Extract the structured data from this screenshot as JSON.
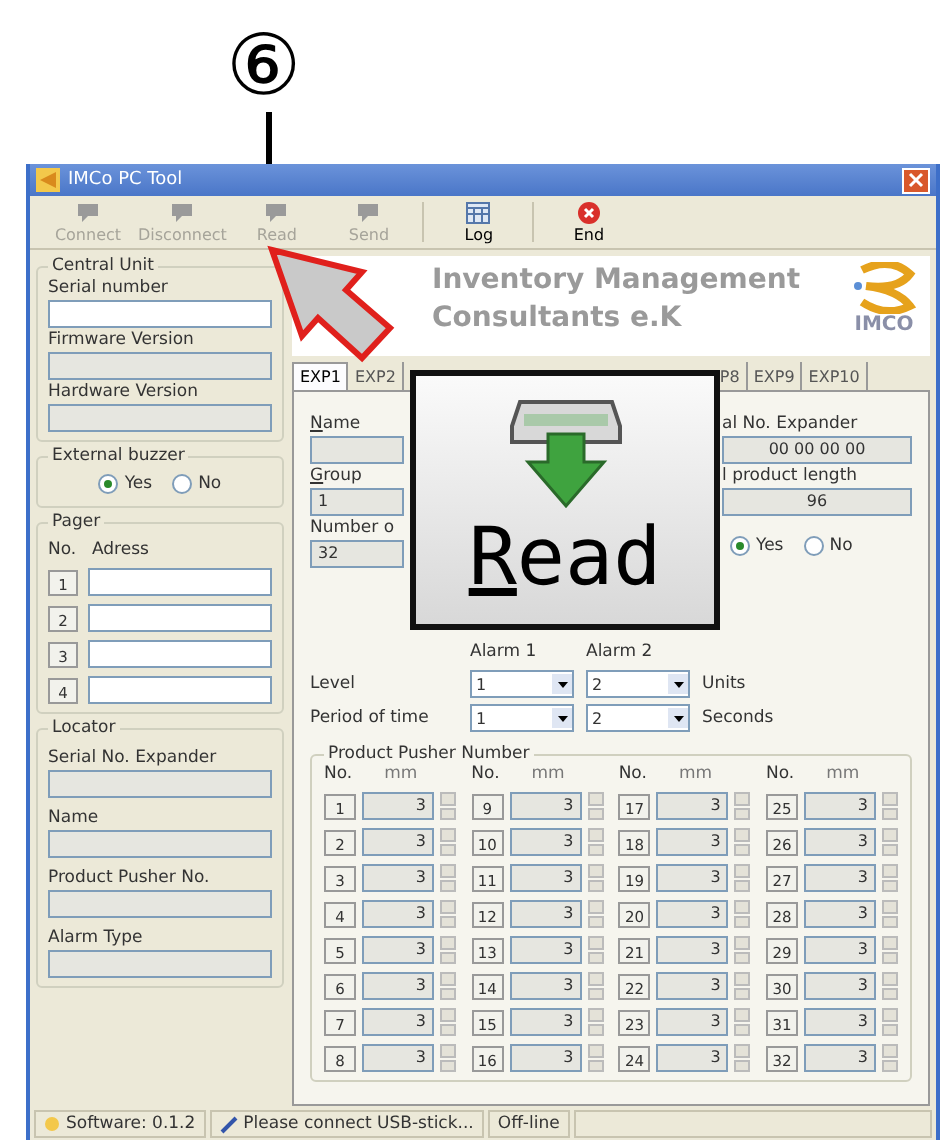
{
  "annotation": {
    "number": "⑥"
  },
  "callout": {
    "label": "Read"
  },
  "window": {
    "title": "IMCo PC Tool"
  },
  "toolbar": [
    {
      "label": "Connect",
      "kind": "bubble",
      "disabled": true
    },
    {
      "label": "Disconnect",
      "kind": "bubble",
      "disabled": true
    },
    {
      "label": "Read",
      "kind": "bubble",
      "disabled": true
    },
    {
      "label": "Send",
      "kind": "bubble",
      "disabled": true
    },
    {
      "label": "Log",
      "kind": "log",
      "disabled": false
    },
    {
      "label": "End",
      "kind": "end",
      "disabled": false
    }
  ],
  "central_unit": {
    "title": "Central Unit",
    "fields": [
      {
        "label": "Serial number",
        "editable": true
      },
      {
        "label": "Firmware Version",
        "editable": false
      },
      {
        "label": "Hardware Version",
        "editable": false
      }
    ]
  },
  "external_buzzer": {
    "title": "External buzzer",
    "options": [
      {
        "label": "Yes",
        "selected": true
      },
      {
        "label": "No",
        "selected": false
      }
    ]
  },
  "pager": {
    "title": "Pager",
    "col_no": "No.",
    "col_address": "Adress",
    "rows": [
      "1",
      "2",
      "3",
      "4"
    ]
  },
  "locator": {
    "title": "Locator",
    "fields": [
      "Serial No. Expander",
      "Name",
      "Product Pusher No.",
      "Alarm Type"
    ]
  },
  "header": {
    "line1": "Inventory Management",
    "line2": "Consultants e.K",
    "logo_text": "IMCO"
  },
  "tabs": [
    {
      "label": "EXP1",
      "selected": true
    },
    {
      "label": "EXP2",
      "selected": false
    },
    {
      "label": "P8",
      "selected": false
    },
    {
      "label": "EXP9",
      "selected": false
    },
    {
      "label": "EXP10",
      "selected": false
    }
  ],
  "expander": {
    "name_label": "Name",
    "group_label": "Group",
    "group_value": "1",
    "number_label": "Number o",
    "number_value": "32",
    "serial_label": "al No. Expander",
    "serial_value": "00 00 00 00",
    "length_label": "l product length",
    "length_value": "96",
    "options": [
      {
        "label": "Yes",
        "selected": true
      },
      {
        "label": "No",
        "selected": false
      }
    ]
  },
  "alarms": {
    "headers": [
      "Alarm 1",
      "Alarm 2"
    ],
    "rows": [
      {
        "label": "Level",
        "values": [
          "1",
          "2"
        ],
        "unit": "Units"
      },
      {
        "label": "Period of time",
        "values": [
          "1",
          "2"
        ],
        "unit": "Seconds"
      }
    ]
  },
  "pushers": {
    "title": "Product Pusher Number",
    "groups": [
      {
        "col_no": "No.",
        "col_mm": "mm",
        "items": [
          {
            "no": "1",
            "mm": "3"
          },
          {
            "no": "2",
            "mm": "3"
          },
          {
            "no": "3",
            "mm": "3"
          },
          {
            "no": "4",
            "mm": "3"
          },
          {
            "no": "5",
            "mm": "3"
          },
          {
            "no": "6",
            "mm": "3"
          },
          {
            "no": "7",
            "mm": "3"
          },
          {
            "no": "8",
            "mm": "3"
          }
        ]
      },
      {
        "col_no": "No.",
        "col_mm": "mm",
        "items": [
          {
            "no": "9",
            "mm": "3"
          },
          {
            "no": "10",
            "mm": "3"
          },
          {
            "no": "11",
            "mm": "3"
          },
          {
            "no": "12",
            "mm": "3"
          },
          {
            "no": "13",
            "mm": "3"
          },
          {
            "no": "14",
            "mm": "3"
          },
          {
            "no": "15",
            "mm": "3"
          },
          {
            "no": "16",
            "mm": "3"
          }
        ]
      },
      {
        "col_no": "No.",
        "col_mm": "mm",
        "items": [
          {
            "no": "17",
            "mm": "3"
          },
          {
            "no": "18",
            "mm": "3"
          },
          {
            "no": "19",
            "mm": "3"
          },
          {
            "no": "20",
            "mm": "3"
          },
          {
            "no": "21",
            "mm": "3"
          },
          {
            "no": "22",
            "mm": "3"
          },
          {
            "no": "23",
            "mm": "3"
          },
          {
            "no": "24",
            "mm": "3"
          }
        ]
      },
      {
        "col_no": "No.",
        "col_mm": "mm",
        "items": [
          {
            "no": "25",
            "mm": "3"
          },
          {
            "no": "26",
            "mm": "3"
          },
          {
            "no": "27",
            "mm": "3"
          },
          {
            "no": "28",
            "mm": "3"
          },
          {
            "no": "29",
            "mm": "3"
          },
          {
            "no": "30",
            "mm": "3"
          },
          {
            "no": "31",
            "mm": "3"
          },
          {
            "no": "32",
            "mm": "3"
          }
        ]
      }
    ]
  },
  "status_bar": [
    "Software: 0.1.2",
    "Please connect USB-stick...",
    "Off-line"
  ]
}
